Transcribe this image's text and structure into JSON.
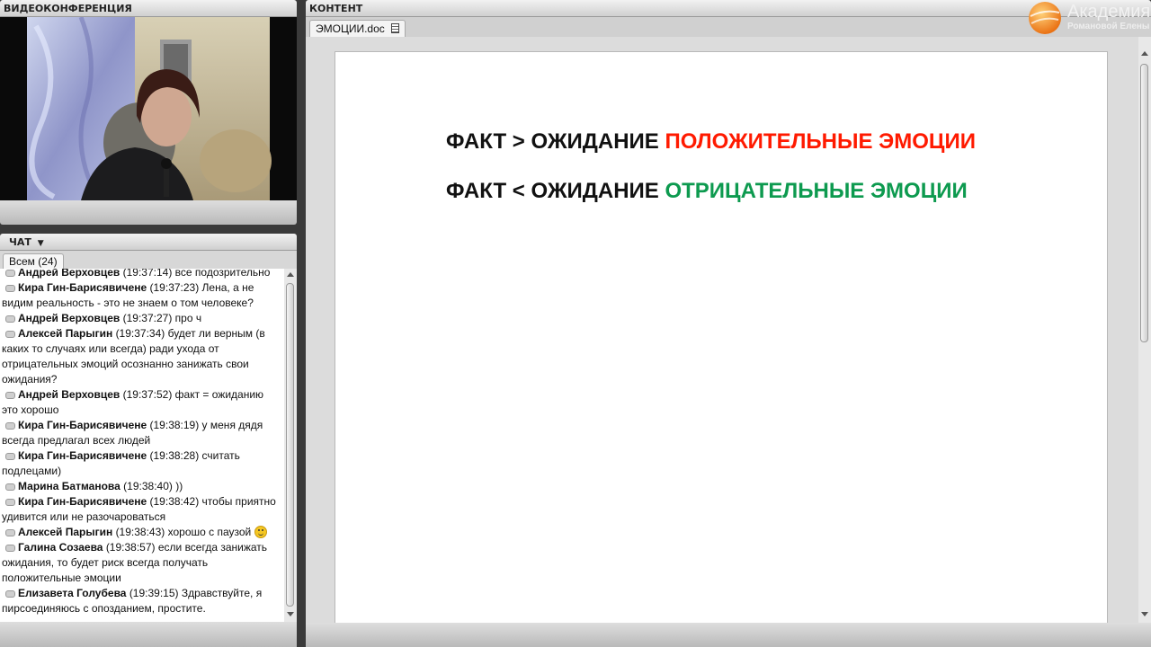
{
  "video_panel": {
    "title": "ВИДЕОКОНФЕРЕНЦИЯ"
  },
  "chat_panel": {
    "title": "ЧАТ",
    "tab_label": "Всем (24)",
    "messages": [
      {
        "name": "Андрей Верховцев",
        "text": "(19:37:14) все подозрительно"
      },
      {
        "name": "Кира Гин-Барисявичене",
        "text": " (19:37:23) Лена, а не видим реальность - это не знаем о том человеке?"
      },
      {
        "name": "Андрей Верховцев",
        "text": "(19:37:27) про ч"
      },
      {
        "name": "Алексей Парыгин",
        "text": "(19:37:34) будет ли верным (в каких то случаях или всегда) ради ухода от отрицательных эмоций осознанно занижать свои ожидания?"
      },
      {
        "name": "Андрей Верховцев",
        "text": "(19:37:52) факт = ожиданию это хорошо"
      },
      {
        "name": "Кира Гин-Барисявичене",
        "text": " (19:38:19) у меня дядя всегда предлагал всех людей"
      },
      {
        "name": "Кира Гин-Барисявичене",
        "text": " (19:38:28) считать подлецами)"
      },
      {
        "name": "Марина Батманова",
        "text": "(19:38:40)  ))"
      },
      {
        "name": "Кира Гин-Барисявичене",
        "text": " (19:38:42) чтобы приятно удивится или не разочароваться"
      },
      {
        "name": "Алексей Парыгин",
        "text": "(19:38:43) хорошо с паузой",
        "smiley": true
      },
      {
        "name": "Галина Созаева",
        "text": "(19:38:57) если всегда занижать ожидания, то будет риск всегда получать положительные эмоции"
      },
      {
        "name": "Елизавета Голубева",
        "text": "(19:39:15) Здравствуйте, я пирсоединяюсь с опозданием, простите."
      }
    ]
  },
  "content_panel": {
    "title": "КОНТЕНТ",
    "doc_tab": "ЭМОЦИИ.doc",
    "line1_black": "ФАКТ > ОЖИДАНИЕ ",
    "line1_red": "ПОЛОЖИТЕЛЬНЫЕ ЭМОЦИИ",
    "line2_black": "ФАКТ < ОЖИДАНИЕ ",
    "line2_green": "ОТРИЦАТЕЛЬНЫЕ ЭМОЦИИ"
  },
  "brand": {
    "name": "Академия",
    "sub": "Романовой Елены"
  },
  "colors": {
    "red": "#ff1a00",
    "green": "#0d9a4f",
    "logo_orange": "#f28a1a"
  }
}
